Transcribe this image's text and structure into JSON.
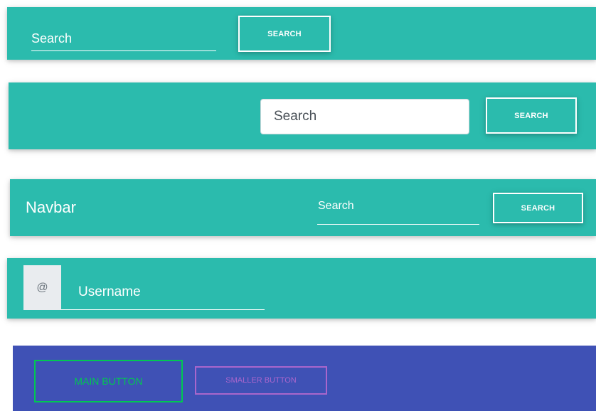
{
  "bars": {
    "bar1": {
      "search_input": {
        "placeholder": "Search"
      },
      "search_button": "SEARCH"
    },
    "bar2": {
      "search_input": {
        "placeholder": "Search"
      },
      "search_button": "SEARCH"
    },
    "bar3": {
      "brand": "Navbar",
      "search_input": {
        "placeholder": "Search"
      },
      "search_button": "SEARCH"
    },
    "bar4": {
      "addon": "@",
      "username_input": {
        "placeholder": "Username"
      }
    },
    "bar5": {
      "main_button": "MAIN BUTTON",
      "smaller_button": "SMALLER BUTTON"
    }
  },
  "colors": {
    "teal": "#2bbbad",
    "indigo": "#3f51b5",
    "green": "#00c851",
    "purple": "#aa66cc",
    "white": "#ffffff"
  }
}
